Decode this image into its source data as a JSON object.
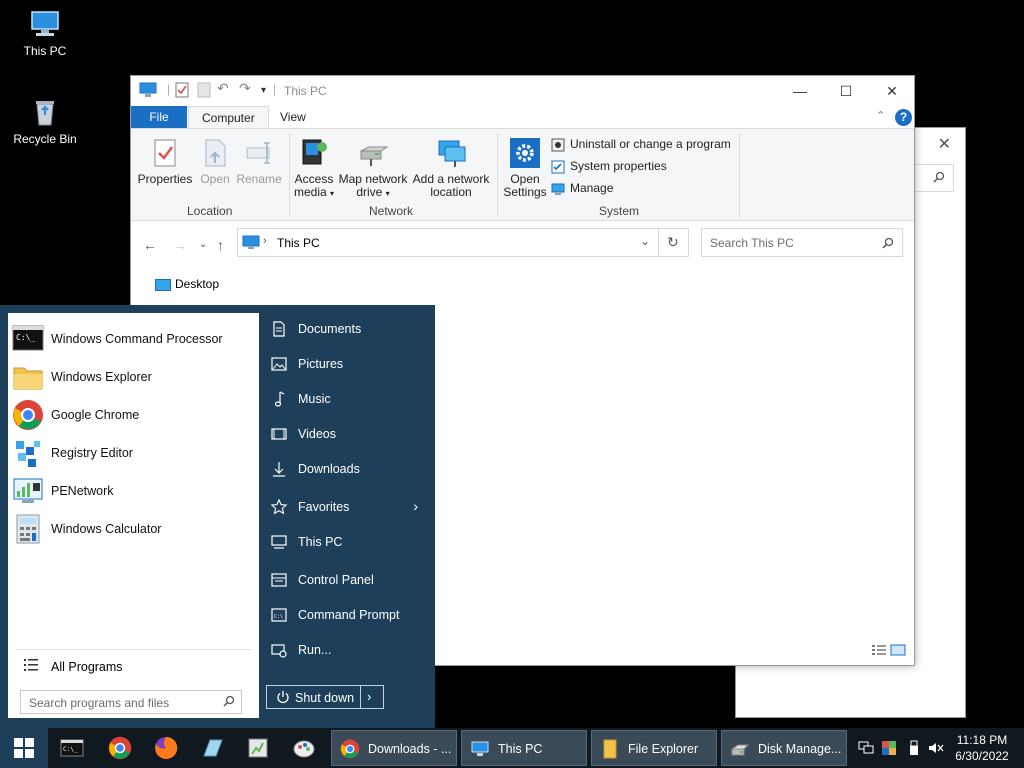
{
  "desktop": {
    "icons": [
      {
        "label": "This PC"
      },
      {
        "label": "Recycle Bin"
      }
    ]
  },
  "explorer": {
    "title": "This PC",
    "tabs": {
      "file": "File",
      "computer": "Computer",
      "view": "View"
    },
    "ribbon": {
      "properties": "Properties",
      "open": "Open",
      "rename": "Rename",
      "access_media": "Access media",
      "map_network_drive": "Map network drive",
      "add_network_location": "Add a network location",
      "open_settings": "Open Settings",
      "uninstall": "Uninstall or change a program",
      "system_properties": "System properties",
      "manage": "Manage",
      "groups": {
        "location": "Location",
        "network": "Network",
        "system": "System"
      }
    },
    "address": "This PC",
    "search_placeholder": "Search This PC",
    "content_items": [
      "Desktop"
    ]
  },
  "start_menu": {
    "apps": [
      {
        "label": "Windows Command Processor",
        "icon": "cmd-icon"
      },
      {
        "label": "Windows Explorer",
        "icon": "folder-icon"
      },
      {
        "label": "Google Chrome",
        "icon": "chrome-icon"
      },
      {
        "label": "Registry Editor",
        "icon": "registry-icon"
      },
      {
        "label": "PENetwork",
        "icon": "network-icon"
      },
      {
        "label": "Windows Calculator",
        "icon": "calculator-icon"
      }
    ],
    "all_programs": "All Programs",
    "search_placeholder": "Search programs and files",
    "links": [
      {
        "label": "Documents",
        "icon": "document-icon"
      },
      {
        "label": "Pictures",
        "icon": "picture-icon"
      },
      {
        "label": "Music",
        "icon": "music-icon"
      },
      {
        "label": "Videos",
        "icon": "video-icon"
      },
      {
        "label": "Downloads",
        "icon": "download-icon"
      },
      {
        "label": "Favorites",
        "icon": "star-icon"
      },
      {
        "label": "This PC",
        "icon": "computer-icon"
      },
      {
        "label": "Control Panel",
        "icon": "control-panel-icon"
      },
      {
        "label": "Command Prompt",
        "icon": "cmd-icon"
      },
      {
        "label": "Run...",
        "icon": "run-icon"
      }
    ],
    "shutdown": "Shut down"
  },
  "taskbar": {
    "tasks": [
      {
        "label": "Downloads - ...",
        "icon": "chrome-icon"
      },
      {
        "label": "This PC",
        "icon": "computer-icon"
      },
      {
        "label": "File Explorer",
        "icon": "folder-icon"
      },
      {
        "label": "Disk Manage...",
        "icon": "disk-icon"
      }
    ],
    "time": "11:18 PM",
    "date": "6/30/2022"
  },
  "colors": {
    "accent": "#1a6fc4",
    "start_bg": "#1e3f5a",
    "taskbar_bg": "#101820"
  }
}
